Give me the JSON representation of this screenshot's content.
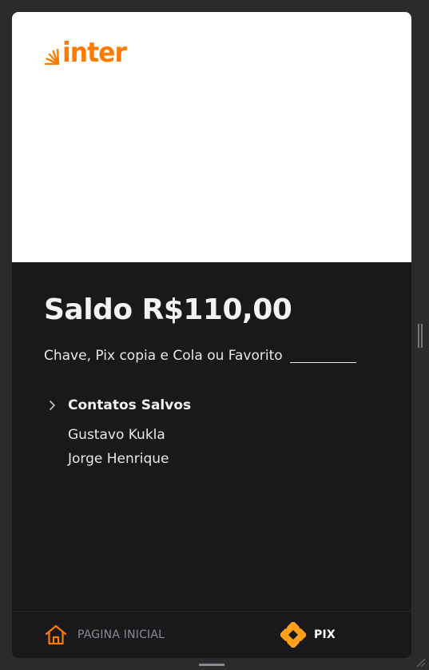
{
  "app": {
    "logo_text": "inter",
    "brand_color": "#ff7a00"
  },
  "main": {
    "balance": "Saldo R$110,00",
    "pix_input": {
      "placeholder": "Chave, Pix copia e Cola ou Favorito",
      "value": ""
    },
    "contacts": {
      "title": "Contatos Salvos",
      "items": [
        {
          "name": "Gustavo Kukla"
        },
        {
          "name": "Jorge Henrique"
        }
      ]
    }
  },
  "bottom_nav": {
    "items": [
      {
        "label": "PAGINA INICIAL",
        "icon": "home-icon"
      },
      {
        "label": "PIX",
        "icon": "pix-icon"
      }
    ]
  },
  "colors": {
    "background": "#19191c",
    "header": "#ffffff",
    "accent": "#ff7a00",
    "pix_icon": "#ff9f1a"
  }
}
